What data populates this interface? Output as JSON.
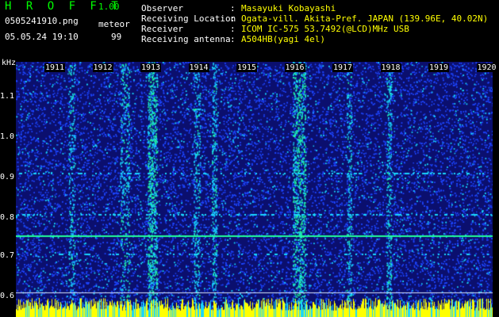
{
  "header": {
    "app_title": "H R O F F T",
    "app_version": "1.00",
    "file_name": "0505241910.png",
    "mode_label": "meteor",
    "datetime": "05.05.24 19:10",
    "count": "99"
  },
  "info": {
    "observer_label": "Observer",
    "observer_value": "Masayuki Kobayashi",
    "location_label": "Receiving Location",
    "location_value": "Ogata-vill. Akita-Pref. JAPAN (139.96E, 40.02N)",
    "receiver_label": "Receiver",
    "receiver_value": "ICOM IC-575 53.7492(@LCD)MHz USB",
    "antenna_label": "Receiving antenna",
    "antenna_value": "A504HB(yagi 4el)",
    "separator": ":"
  },
  "spectrogram": {
    "y_unit": "kHz",
    "y_ticks": [
      "1.1",
      "1.0",
      "0.9",
      "0.8",
      "0.7",
      "0.6"
    ],
    "x_ticks": [
      "1911",
      "1912",
      "1913",
      "1914",
      "1915",
      "1916",
      "1917",
      "1918",
      "1919",
      "1920"
    ],
    "colors": {
      "background": "#0b0f6e",
      "noise": "#1e46ff",
      "signal": "#19d6ff",
      "strong": "#22ff9a",
      "peak": "#ffff00"
    }
  }
}
